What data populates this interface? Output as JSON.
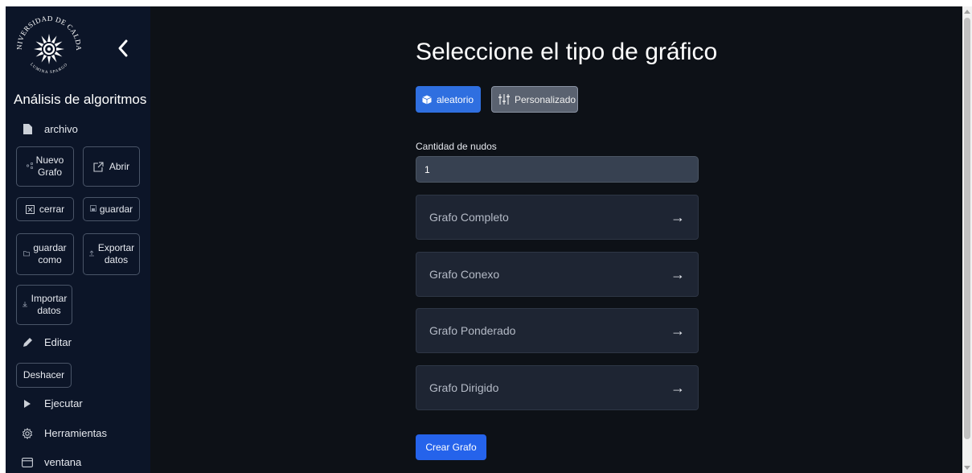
{
  "sidebar": {
    "logo": {
      "text_top": "UNIVERSIDAD DE CALDAS",
      "text_bottom": "LUMINA SPARGO"
    },
    "title": "Análisis de algoritmos",
    "archivo_label": "archivo",
    "buttons": {
      "nuevo_grafo": [
        "Nuevo",
        "Grafo"
      ],
      "abrir": "Abrir",
      "cerrar": "cerrar",
      "guardar": "guardar",
      "guardar_como": [
        "guardar",
        "como"
      ],
      "exportar_datos": [
        "Exportar",
        "datos"
      ],
      "importar_datos": [
        "Importar",
        "datos"
      ],
      "deshacer": "Deshacer"
    },
    "editar_label": "Editar",
    "ejecutar_label": "Ejecutar",
    "herramientas_label": "Herramientas",
    "ventana_label": "ventana"
  },
  "main": {
    "heading": "Seleccione el tipo de gráfico",
    "toggles": {
      "random_label": "aleatorio",
      "custom_label": "Personalizado"
    },
    "quantity": {
      "label": "Cantidad de nudos",
      "value": "1"
    },
    "graph_options": [
      {
        "label": "Grafo Completo"
      },
      {
        "label": "Grafo Conexo"
      },
      {
        "label": "Grafo Ponderado"
      },
      {
        "label": "Grafo Dirigido"
      }
    ],
    "create_button": "Crear Grafo"
  },
  "colors": {
    "sidebar_bg": "#0c1528",
    "main_bg": "#0d1117",
    "accent": "#2f6fe0",
    "card_bg": "#1e2533",
    "input_bg": "#374151"
  },
  "icons": {
    "collapse": "chevron-left-icon",
    "archivo": "file-icon",
    "nuevo_grafo": "share-nodes-icon",
    "abrir": "external-link-icon",
    "cerrar": "close-box-icon",
    "guardar": "save-icon",
    "editar": "pencil-icon",
    "ejecutar": "play-icon",
    "herramientas": "gear-icon",
    "ventana": "window-icon",
    "aleatorio": "dice-icon",
    "personalizado": "sliders-icon",
    "card_arrow": "arrow-right-icon"
  }
}
